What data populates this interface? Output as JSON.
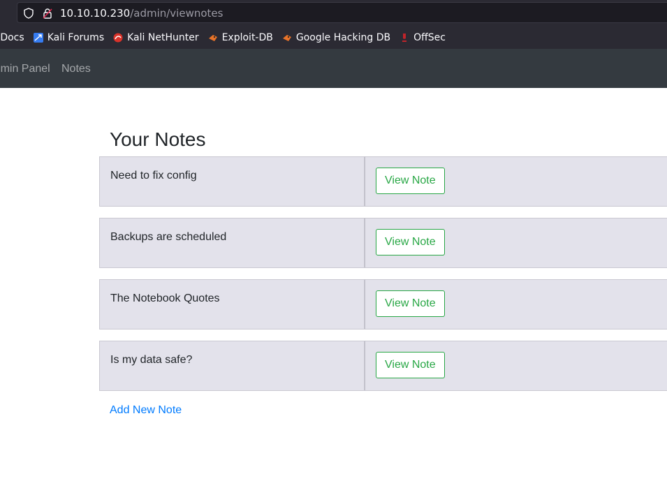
{
  "browser": {
    "url_host": "10.10.10.230",
    "url_path": "/admin/viewnotes",
    "bookmarks": [
      {
        "label": "i Docs",
        "icon": "kali-docs-icon"
      },
      {
        "label": "Kali Forums",
        "icon": "kali-forums-icon"
      },
      {
        "label": "Kali NetHunter",
        "icon": "kali-nethunter-icon"
      },
      {
        "label": "Exploit-DB",
        "icon": "exploit-db-icon"
      },
      {
        "label": "Google Hacking DB",
        "icon": "ghdb-icon"
      },
      {
        "label": "OffSec",
        "icon": "offsec-icon"
      }
    ]
  },
  "navbar": {
    "admin_label": "Admin Panel",
    "notes_label": "Notes"
  },
  "page": {
    "title": "Your Notes",
    "notes": [
      {
        "title": "Need to fix config",
        "button": "View Note"
      },
      {
        "title": "Backups are scheduled",
        "button": "View Note"
      },
      {
        "title": "The Notebook Quotes",
        "button": "View Note"
      },
      {
        "title": "Is my data safe?",
        "button": "View Note"
      }
    ],
    "add_label": "Add New Note"
  },
  "colors": {
    "navbar_bg": "#343a40",
    "button_green": "#28a745",
    "link_blue": "#007bff",
    "row_bg": "#e3e2eb"
  }
}
